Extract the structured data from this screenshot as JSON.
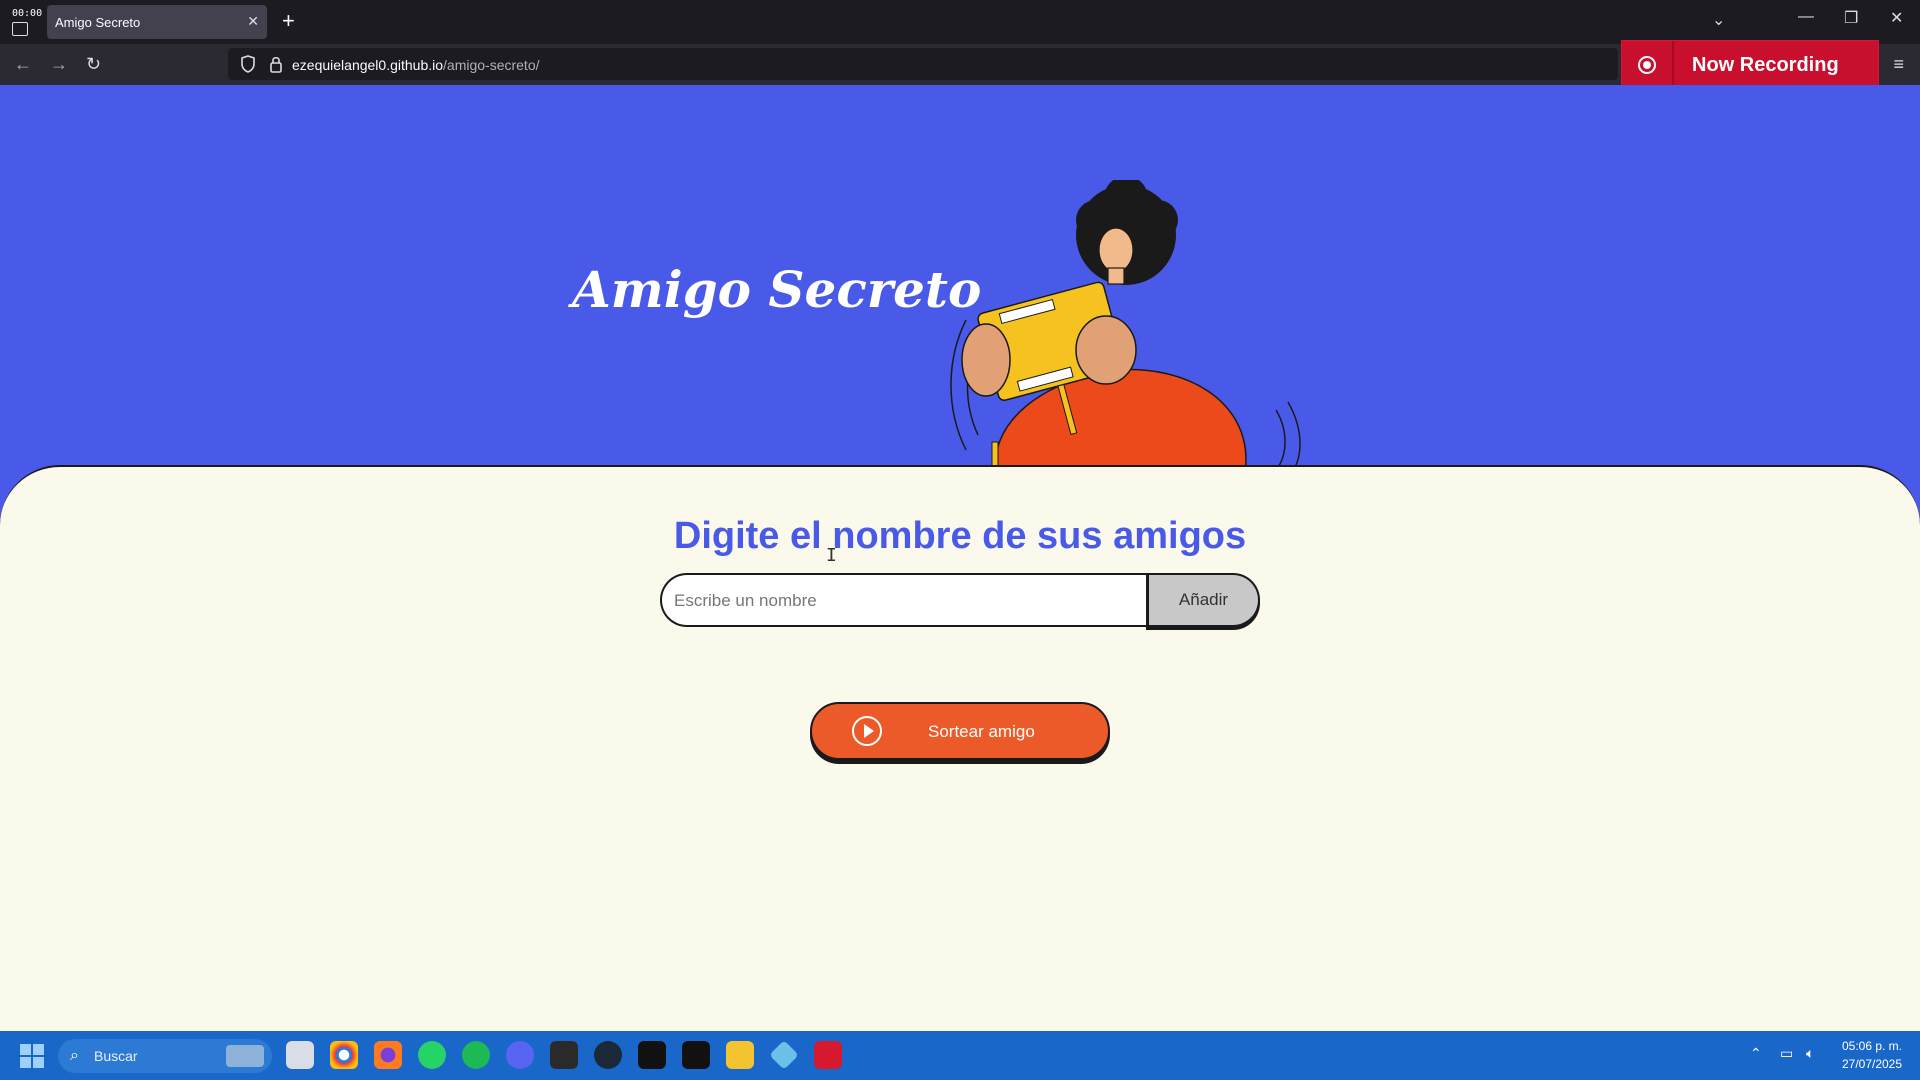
{
  "browser": {
    "recorder_timer": "00:00",
    "tab_title": "Amigo Secreto",
    "url_domain": "ezequielangel0.github.io",
    "url_path": "/amigo-secreto/"
  },
  "recording": {
    "label": "Now Recording"
  },
  "page": {
    "hero_title": "Amigo Secreto",
    "heading": "Digite el nombre de sus amigos",
    "input_placeholder": "Escribe un nombre",
    "add_label": "Añadir",
    "draw_label": "Sortear amigo"
  },
  "taskbar": {
    "search_placeholder": "Buscar",
    "time": "05:06 p. m.",
    "date": "27/07/2025"
  }
}
